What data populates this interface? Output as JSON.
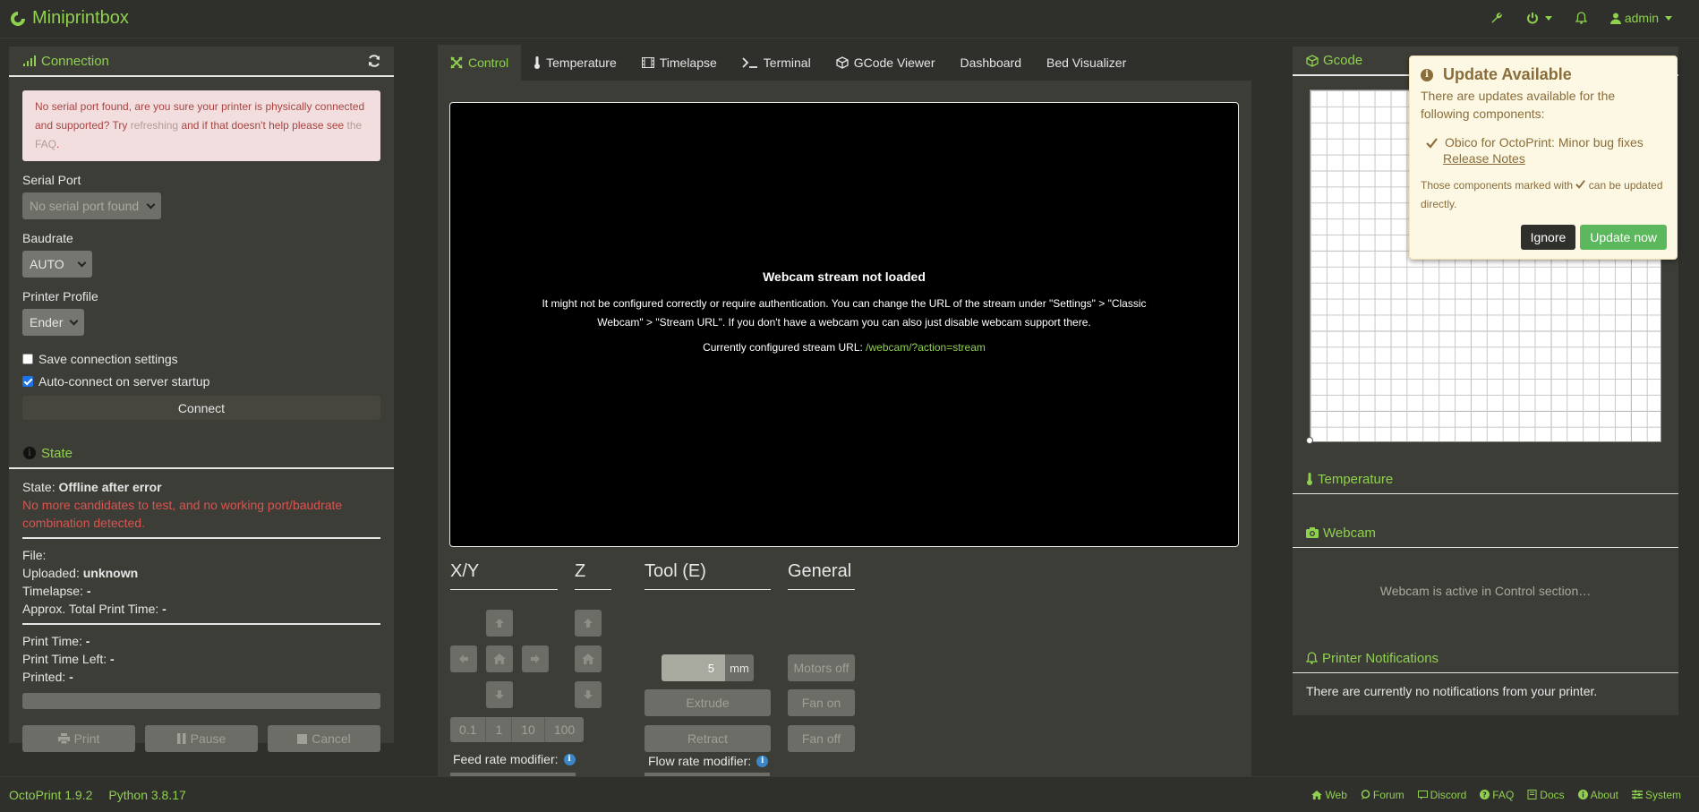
{
  "navbar": {
    "brand": "Miniprintbox",
    "user": "admin"
  },
  "connection": {
    "title": "Connection",
    "alert": {
      "pre": "No serial port found, are you sure your printer is physically connected and supported? Try ",
      "link1": "refreshing",
      "mid": " and if that doesn't help please see ",
      "link2": "the FAQ",
      "post": "."
    },
    "serial_port_label": "Serial Port",
    "serial_port_value": "No serial port found",
    "baudrate_label": "Baudrate",
    "baudrate_value": "AUTO",
    "profile_label": "Printer Profile",
    "profile_value": "Ender",
    "save_settings_label": "Save connection settings",
    "autoconnect_label": "Auto-connect on server startup",
    "connect_label": "Connect"
  },
  "state": {
    "title": "State",
    "state_label": "State:",
    "state_value": "Offline after error",
    "error": "No more candidates to test, and no working port/baudrate combination detected.",
    "file_label": "File:",
    "uploaded_label": "Uploaded:",
    "uploaded_value": "unknown",
    "timelapse_label": "Timelapse:",
    "timelapse_value": "-",
    "approx_label": "Approx. Total Print Time:",
    "approx_value": "-",
    "print_time_label": "Print Time:",
    "print_time_value": "-",
    "time_left_label": "Print Time Left:",
    "time_left_value": "-",
    "printed_label": "Printed:",
    "printed_value": "-",
    "progress": 0,
    "print_label": "Print",
    "pause_label": "Pause",
    "cancel_label": "Cancel"
  },
  "tabs": [
    {
      "label": "Control",
      "icon": "arrows-icon"
    },
    {
      "label": "Temperature",
      "icon": "thermometer-icon"
    },
    {
      "label": "Timelapse",
      "icon": "film-icon"
    },
    {
      "label": "Terminal",
      "icon": "terminal-icon"
    },
    {
      "label": "GCode Viewer",
      "icon": "cube-icon"
    },
    {
      "label": "Dashboard",
      "icon": ""
    },
    {
      "label": "Bed Visualizer",
      "icon": ""
    }
  ],
  "webcam": {
    "title": "Webcam stream not loaded",
    "message": "It might not be configured correctly or require authentication. You can change the URL of the stream under \"Settings\" > \"Classic Webcam\" > \"Stream URL\". If you don't have a webcam you can also just disable webcam support there.",
    "url_label": "Currently configured stream URL:",
    "url": "/webcam/?action=stream"
  },
  "control": {
    "xy_title": "X/Y",
    "z_title": "Z",
    "tool_title": "Tool (E)",
    "general_title": "General",
    "steps": [
      "0.1",
      "1",
      "10",
      "100"
    ],
    "extrude_amount": "5",
    "extrude_unit": "mm",
    "extrude_label": "Extrude",
    "retract_label": "Retract",
    "motors_off_label": "Motors off",
    "fan_on_label": "Fan on",
    "fan_off_label": "Fan off",
    "feed_rate_label": "Feed rate modifier:",
    "flow_rate_label": "Flow rate modifier:"
  },
  "right": {
    "gcode_title": "Gcode",
    "temperature_title": "Temperature",
    "webcam_title": "Webcam",
    "webcam_active": "Webcam is active in Control section…",
    "notifications_title": "Printer Notifications",
    "no_notifications": "There are currently no notifications from your printer."
  },
  "update_popup": {
    "title": "Update Available",
    "intro": "There are updates available for the following components:",
    "item": "Obico for OctoPrint: Minor bug fixes",
    "release_notes": "Release Notes",
    "note_pre": "Those components marked with",
    "note_post": "can be updated directly.",
    "ignore_label": "Ignore",
    "update_label": "Update now"
  },
  "footer": {
    "octoprint_version": "OctoPrint 1.9.2",
    "python_version": "Python 3.8.17",
    "links": [
      "Web",
      "Forum",
      "Discord",
      "FAQ",
      "Docs",
      "About",
      "System"
    ]
  }
}
